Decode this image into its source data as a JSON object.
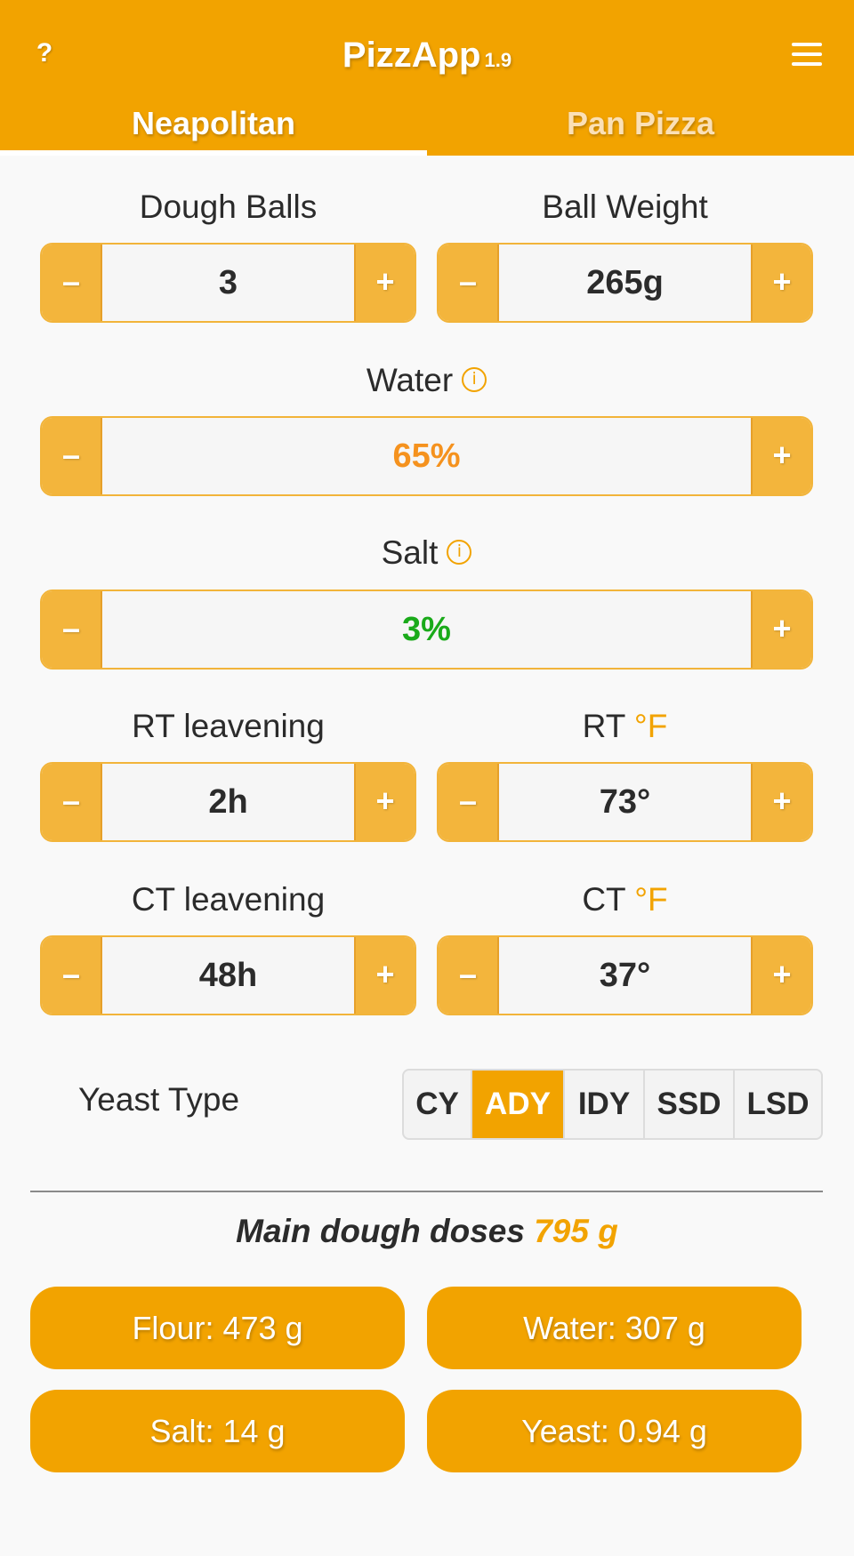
{
  "header": {
    "help_label": "?",
    "title": "PizzApp",
    "version": "1.9",
    "menu_icon": "hamburger-menu-icon",
    "tabs": [
      {
        "label": "Neapolitan",
        "active": true
      },
      {
        "label": "Pan Pizza",
        "active": false
      }
    ],
    "accent_color": "#f2a300"
  },
  "controls": {
    "dough_balls": {
      "label": "Dough Balls",
      "value": "3",
      "minus": "–",
      "plus": "+"
    },
    "ball_weight": {
      "label": "Ball Weight",
      "value": "265g",
      "minus": "–",
      "plus": "+"
    },
    "water": {
      "label": "Water",
      "value": "65%",
      "value_color": "#f5921e",
      "info_icon": "info-icon",
      "minus": "–",
      "plus": "+"
    },
    "salt": {
      "label": "Salt",
      "value": "3%",
      "value_color": "#1aaa1a",
      "info_icon": "info-icon",
      "minus": "–",
      "plus": "+"
    },
    "rt_leavening": {
      "label": "RT leavening",
      "value": "2h",
      "minus": "–",
      "plus": "+"
    },
    "rt_temp": {
      "label": "RT",
      "unit": "°F",
      "value": "73°",
      "minus": "–",
      "plus": "+"
    },
    "ct_leavening": {
      "label": "CT leavening",
      "value": "48h",
      "minus": "–",
      "plus": "+"
    },
    "ct_temp": {
      "label": "CT",
      "unit": "°F",
      "value": "37°",
      "minus": "–",
      "plus": "+"
    }
  },
  "yeast": {
    "label": "Yeast Type",
    "options": [
      "CY",
      "ADY",
      "IDY",
      "SSD",
      "LSD"
    ],
    "selected": "ADY"
  },
  "results": {
    "title": "Main dough doses",
    "total": "795 g",
    "items": [
      "Flour: 473 g",
      "Water: 307 g",
      "Salt: 14 g",
      "Yeast: 0.94 g"
    ]
  }
}
